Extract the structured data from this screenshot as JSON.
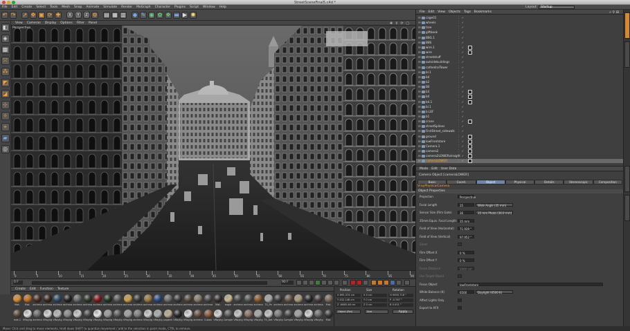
{
  "window": {
    "title": "StreetSceneFinal5.c4d *"
  },
  "menubar": {
    "items": [
      "File",
      "Edit",
      "Create",
      "Select",
      "Tools",
      "Mesh",
      "Snap",
      "Animate",
      "Simulate",
      "Render",
      "MoGraph",
      "Character",
      "Plugins",
      "Script",
      "Window",
      "Help"
    ],
    "layout_label": "Layout:",
    "layout_value": "Startup"
  },
  "viewport": {
    "menu": [
      "View",
      "Cameras",
      "Display",
      "Options",
      "Filter",
      "Panel"
    ],
    "label": "Perspective"
  },
  "timeline": {
    "ticks": [
      "0",
      "5",
      "10",
      "15",
      "20",
      "25",
      "30",
      "35",
      "40",
      "45",
      "50",
      "55",
      "60",
      "65",
      "70",
      "75",
      "80",
      "85",
      "90"
    ],
    "frame_field": "0 F",
    "end_field": "90 F"
  },
  "materials": {
    "menu": [
      "Create",
      "Edit",
      "Function",
      "Texture"
    ],
    "row1": [
      {
        "label": "Mat.",
        "color": "#d88a2a"
      },
      {
        "label": "Mat.",
        "color": "#c07020"
      },
      {
        "label": "archma",
        "color": "#4a3020"
      },
      {
        "label": "archma",
        "color": "#3a2a1c"
      },
      {
        "label": "archma",
        "color": "#2f4a6a"
      },
      {
        "label": "archma",
        "color": "#262626"
      },
      {
        "label": "archma",
        "color": "#6a6a6a"
      },
      {
        "label": "archma",
        "color": "#2e3a2a"
      },
      {
        "label": "archma",
        "color": "#8a1a1a"
      },
      {
        "label": "archma",
        "color": "#243a24"
      },
      {
        "label": "archma",
        "color": "#5a5a5a"
      },
      {
        "label": "archma",
        "color": "#d0a040"
      },
      {
        "label": "archma",
        "color": "#3a3a3a"
      },
      {
        "label": "archma",
        "color": "#9a7a40"
      },
      {
        "label": "archma",
        "color": "#2a4a8a"
      },
      {
        "label": "archma",
        "color": "#707070"
      },
      {
        "label": "archma",
        "color": "#3c3c3c"
      },
      {
        "label": "archma",
        "color": "#5a4a3a"
      },
      {
        "label": "archma",
        "color": "#8a7a6a"
      },
      {
        "label": "archma",
        "color": "#4a4a4a"
      },
      {
        "label": "Mat.",
        "color": "#3a3030"
      },
      {
        "label": "eagle",
        "color": "#c8b890"
      },
      {
        "label": "archma",
        "color": "#4c4c4c"
      },
      {
        "label": "archma",
        "color": "#555555"
      },
      {
        "label": "archma",
        "color": "#8a5a2a"
      },
      {
        "label": "TS_Pa",
        "color": "#a8a8a8"
      },
      {
        "label": "archma",
        "color": "#3e3e3e"
      },
      {
        "label": "archma",
        "color": "#6a5a4a"
      },
      {
        "label": "archma",
        "color": "#a89a7a"
      },
      {
        "label": "archma",
        "color": "#2a2a2a"
      },
      {
        "label": "archma",
        "color": "#4a4040"
      },
      {
        "label": "Mat.",
        "color": "#7a6a5a"
      }
    ],
    "row2": [
      {
        "label": "mat.1",
        "color": "#5a4a3a"
      },
      {
        "label": "VRaylig",
        "color": "#e0e0e0"
      },
      {
        "label": "archma",
        "color": "#6a6a6a"
      },
      {
        "label": "VRaylig",
        "color": "#d8d8d8"
      },
      {
        "label": "VRaylig",
        "color": "#bcbcbc"
      },
      {
        "label": "VRaylig",
        "color": "#8a8a8a"
      },
      {
        "label": "VRaylig",
        "color": "#d0d0d0"
      },
      {
        "label": "VRaylig",
        "color": "#4a4a4a"
      },
      {
        "label": "VRaylig",
        "color": "#e8e8e8"
      },
      {
        "label": "VRaylig",
        "color": "#9a9a9a"
      },
      {
        "label": "VRaylig",
        "color": "#5a5a5a"
      },
      {
        "label": "VRaylig",
        "color": "#a0a0a0"
      },
      {
        "label": "archma",
        "color": "#808080"
      },
      {
        "label": "VRaylig",
        "color": "#cfcfcf"
      },
      {
        "label": "VRaylig",
        "color": "#b0b0b0"
      },
      {
        "label": "paperb",
        "color": "#c0b090"
      },
      {
        "label": "VRaylig",
        "color": "#2a2a2a"
      },
      {
        "label": "VRaylig",
        "color": "#e0e0e0"
      },
      {
        "label": "archma",
        "color": "#6a5040"
      },
      {
        "label": "Cuban",
        "color": "#8a5a3a"
      },
      {
        "label": "VRaylig",
        "color": "#d8d8d8"
      },
      {
        "label": "Comple",
        "color": "#5a5a5a"
      },
      {
        "label": "VRaylig",
        "color": "#cacaca"
      },
      {
        "label": "VRaylig",
        "color": "#8a7060"
      },
      {
        "label": "VRaylig",
        "color": "#a8a8a8"
      },
      {
        "label": "TS_Det",
        "color": "#c8c8c8"
      },
      {
        "label": "VRaylig",
        "color": "#7a7a7a"
      },
      {
        "label": "Comple",
        "color": "#4a4a4a"
      },
      {
        "label": "VRaylig",
        "color": "#a0a0a0"
      },
      {
        "label": "VRaylig",
        "color": "#d8d8d8"
      },
      {
        "label": "VRaylig",
        "color": "#6a6a6a"
      },
      {
        "label": "Mat.",
        "color": "#3a3a3a"
      }
    ]
  },
  "coords": {
    "heads": [
      "Position",
      "Size",
      "Rotation"
    ],
    "x": {
      "pos": "X 895.374 cm",
      "size": "X 0 cm",
      "rot": "H 9490.718 °"
    },
    "y": {
      "pos": "Y 432.148 cm",
      "size": "Y 0 cm",
      "rot": "P -0.767 °"
    },
    "z": {
      "pos": "Z -6665.46 cm",
      "size": "Z 0 cm",
      "rot": "B 0.001 °"
    },
    "mode": "Object (Rel)",
    "size_mode": "Size",
    "apply": "Apply"
  },
  "status": "Move: Click and drag to move elements. Hold down SHIFT to quantize movement / add to the selection in point mode, CTRL to remove.",
  "objmgr": {
    "menu": [
      "File",
      "Edit",
      "View",
      "Objects",
      "Tags",
      "Bookmarks"
    ],
    "rows": [
      {
        "name": "cage01",
        "tag": false
      },
      {
        "name": "wheels",
        "tag": false
      },
      {
        "name": "tree",
        "tag": false
      },
      {
        "name": "giftbook",
        "tag": false
      },
      {
        "name": "BBG.1",
        "tag": false
      },
      {
        "name": "BBS",
        "tag": false
      },
      {
        "name": "wire.1",
        "tag": true
      },
      {
        "name": "wire",
        "tag": true
      },
      {
        "name": "streetstuff",
        "tag": false
      },
      {
        "name": "outsidebuildings",
        "tag": false
      },
      {
        "name": "cathedralTower",
        "tag": false
      },
      {
        "name": "bl.1",
        "tag": false
      },
      {
        "name": "b4",
        "tag": false
      },
      {
        "name": "b2",
        "tag": false
      },
      {
        "name": "B6",
        "tag": false
      },
      {
        "name": "b3",
        "tag": true
      },
      {
        "name": "b4",
        "tag": true
      },
      {
        "name": "b4.1",
        "tag": true
      },
      {
        "name": "bl.1",
        "tag": false
      },
      {
        "name": "b.LEF",
        "tag": false
      },
      {
        "name": "b1",
        "tag": false
      },
      {
        "name": "crane",
        "tag": true
      },
      {
        "name": "streetSplines",
        "tag": false
      },
      {
        "name": "FirstStreet_sidewalk",
        "tag": false
      },
      {
        "name": "ground",
        "tag": true
      },
      {
        "name": "lowFrontstore",
        "tag": true
      },
      {
        "name": "Camera.1",
        "tag": true
      },
      {
        "name": "camera2",
        "tag": true
      },
      {
        "name": "camera2LOWERstraight",
        "tag": true
      },
      {
        "name": "cameraLOWER",
        "tag": true,
        "selected": true
      }
    ]
  },
  "attr": {
    "menu": [
      "Mode",
      "Edit",
      "User Data"
    ],
    "title": "Camera Object [cameraLOWER]",
    "tabs": [
      "Basic",
      "Coord.",
      "Object",
      "Physical",
      "Details",
      "Stereoscopic",
      "Composition"
    ],
    "active_tab": "Object",
    "subtab": "VrayPhysicalCamera",
    "section": "Object Properties",
    "props": [
      {
        "label": "Projection",
        "value": "Perspective",
        "extra": "",
        "dim": false
      },
      {
        "label": "Focal Length",
        "value": "35",
        "extra": "Wide Angle (35 mm)",
        "dim": false
      },
      {
        "label": "Sensor Size (Film Gate)",
        "value": "36",
        "extra": "35 mm Photo (36.0 mm)",
        "dim": false
      },
      {
        "label": "35mm Equiv. Focal Length:",
        "value": "35 mm",
        "extra": "",
        "dim": false
      },
      {
        "label": "Field of View (Horizontal)",
        "value": "71.939 °",
        "extra": "",
        "dim": false
      },
      {
        "label": "Field of View (Vertical)",
        "value": "97.952 °",
        "extra": "",
        "dim": false
      },
      {
        "label": "Zoom",
        "value": "",
        "extra": "",
        "dim": true
      },
      {
        "label": "Film Offset X",
        "value": "0 %",
        "extra": "",
        "dim": false
      },
      {
        "label": "Film Offset Y",
        "value": "0 %",
        "extra": "",
        "dim": false
      },
      {
        "label": "Focus Distance",
        "value": "2000 cm",
        "extra": "",
        "dim": true
      },
      {
        "label": "Use Target Object",
        "value": "",
        "extra": "",
        "dim": true
      },
      {
        "label": "Focus Object",
        "value": "lowFrontstore",
        "extra": "",
        "dim": false
      },
      {
        "label": "White Balance (K)",
        "value": "6500",
        "extra": "Daylight (6500 K)",
        "dim": false
      },
      {
        "label": "Affect Lights Only",
        "value": "",
        "extra": "",
        "dim": false
      },
      {
        "label": "Export to AFX",
        "value": "",
        "extra": "",
        "dim": false
      }
    ]
  },
  "colors": {
    "accent": "#ff9f2a",
    "tab_active": "#6e85a8"
  }
}
